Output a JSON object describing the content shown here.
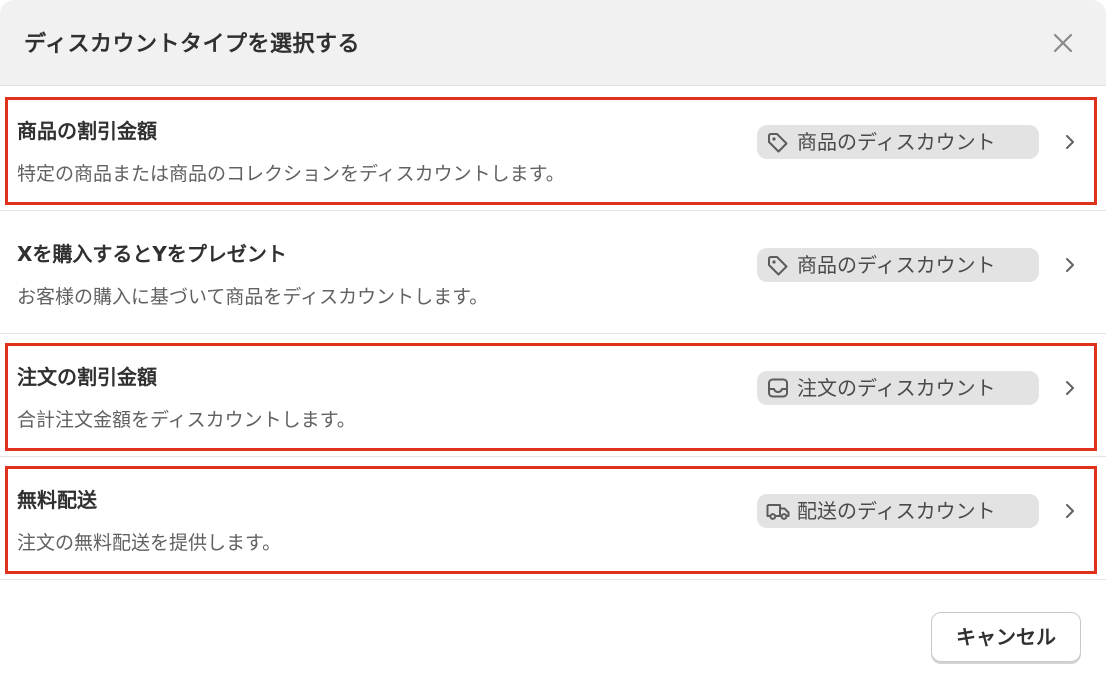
{
  "dialog": {
    "title": "ディスカウントタイプを選択する",
    "close_icon": "close-icon"
  },
  "options": [
    {
      "title": "商品の割引金額",
      "description": "特定の商品または商品のコレクションをディスカウントします。",
      "badge_label": "商品のディスカウント",
      "badge_icon": "tag-icon",
      "highlighted": true
    },
    {
      "title": "Xを購入するとYをプレゼント",
      "description": "お客様の購入に基づいて商品をディスカウントします。",
      "badge_label": "商品のディスカウント",
      "badge_icon": "tag-icon",
      "highlighted": false
    },
    {
      "title": "注文の割引金額",
      "description": "合計注文金額をディスカウントします。",
      "badge_label": "注文のディスカウント",
      "badge_icon": "inbox-tray-icon",
      "highlighted": true
    },
    {
      "title": "無料配送",
      "description": "注文の無料配送を提供します。",
      "badge_label": "配送のディスカウント",
      "badge_icon": "truck-icon",
      "highlighted": true
    }
  ],
  "footer": {
    "cancel_label": "キャンセル"
  },
  "colors": {
    "header_bg": "#f1f1f1",
    "highlight_border": "#e0311c",
    "badge_bg": "#e3e3e3",
    "text_primary": "#303030",
    "text_secondary": "#616161"
  }
}
